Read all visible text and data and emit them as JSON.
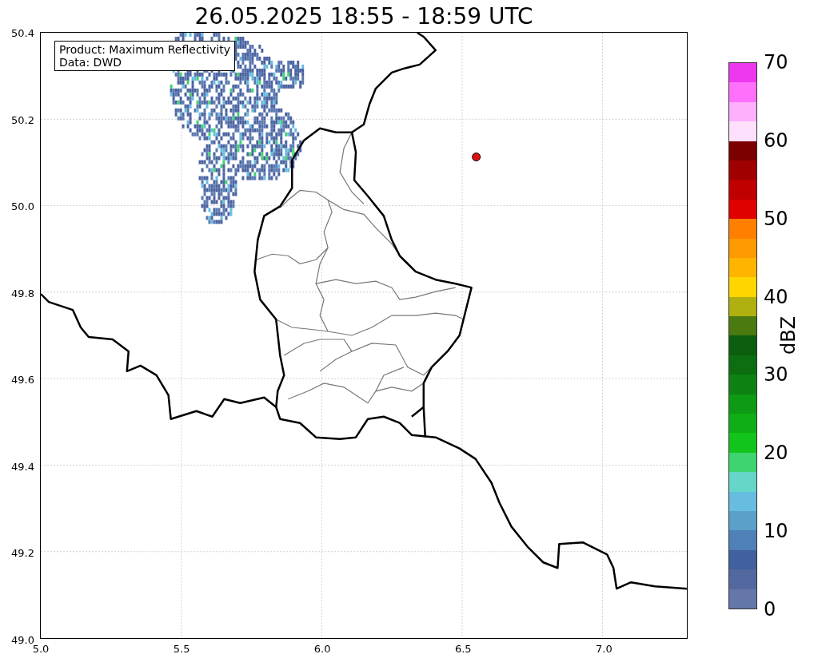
{
  "title": "26.05.2025 18:55 - 18:59 UTC",
  "legend": [
    "Product: Maximum Reflectivity",
    "Data: DWD"
  ],
  "map": {
    "xticks": [
      "5.0",
      "5.5",
      "6.0",
      "6.5",
      "7.0"
    ],
    "yticks": [
      "50.4",
      "50.2",
      "50.0",
      "49.8",
      "49.6",
      "49.4",
      "49.2",
      "49.0"
    ]
  },
  "colorbar": {
    "label": "dBZ",
    "ticks": [
      "70",
      "60",
      "50",
      "40",
      "30",
      "20",
      "10",
      "0"
    ],
    "segments": [
      {
        "color": "#ee38ee"
      },
      {
        "color": "#ff70fc"
      },
      {
        "color": "#ffb0fc"
      },
      {
        "color": "#ffe0fc"
      },
      {
        "color": "#7d0000"
      },
      {
        "color": "#a00000"
      },
      {
        "color": "#c00000"
      },
      {
        "color": "#e00000"
      },
      {
        "color": "#ff7f00"
      },
      {
        "color": "#ff9a00"
      },
      {
        "color": "#ffb400"
      },
      {
        "color": "#ffd600"
      },
      {
        "color": "#b0b010"
      },
      {
        "color": "#4a7a10"
      },
      {
        "color": "#0a5e0e"
      },
      {
        "color": "#0c6e10"
      },
      {
        "color": "#0d8212"
      },
      {
        "color": "#0e9a14"
      },
      {
        "color": "#10ae16"
      },
      {
        "color": "#12c41c"
      },
      {
        "color": "#3ed470"
      },
      {
        "color": "#66d6c8"
      },
      {
        "color": "#66bde0"
      },
      {
        "color": "#5aa0c8"
      },
      {
        "color": "#4f80b8"
      },
      {
        "color": "#4060a0"
      },
      {
        "color": "#5468a0"
      },
      {
        "color": "#6577a8"
      }
    ]
  }
}
